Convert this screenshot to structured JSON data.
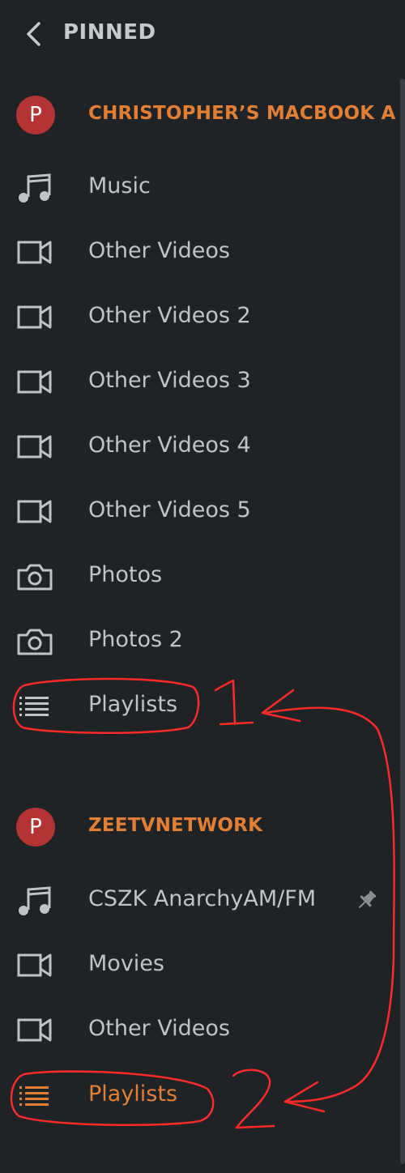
{
  "header": {
    "title": "PINNED",
    "back_icon": "chevron-left-icon"
  },
  "colors": {
    "background": "#1f2326",
    "accent": "#e37f35",
    "avatar": "#b33433",
    "text": "#c2c3c5",
    "annotation": "#ff2a2a"
  },
  "servers": [
    {
      "avatar_letter": "P",
      "name": "CHRISTOPHER’S MACBOOK A...",
      "items": [
        {
          "label": "Music",
          "icon": "music-note-icon"
        },
        {
          "label": "Other Videos",
          "icon": "video-camera-icon"
        },
        {
          "label": "Other Videos 2",
          "icon": "video-camera-icon"
        },
        {
          "label": "Other Videos 3",
          "icon": "video-camera-icon"
        },
        {
          "label": "Other Videos 4",
          "icon": "video-camera-icon"
        },
        {
          "label": "Other Videos 5",
          "icon": "video-camera-icon"
        },
        {
          "label": "Photos",
          "icon": "camera-icon"
        },
        {
          "label": "Photos 2",
          "icon": "camera-icon"
        },
        {
          "label": "Playlists",
          "icon": "list-icon"
        }
      ]
    },
    {
      "avatar_letter": "P",
      "name": "ZEETVNETWORK",
      "items": [
        {
          "label": "CSZK AnarchyAM/FM",
          "icon": "music-note-icon",
          "pinned": true,
          "pin_icon": "pin-icon"
        },
        {
          "label": "Movies",
          "icon": "video-camera-icon"
        },
        {
          "label": "Other Videos",
          "icon": "video-camera-icon"
        },
        {
          "label": "Playlists",
          "icon": "list-icon",
          "active": true
        }
      ]
    }
  ],
  "annotations": {
    "label_1": "1",
    "label_2": "2"
  }
}
